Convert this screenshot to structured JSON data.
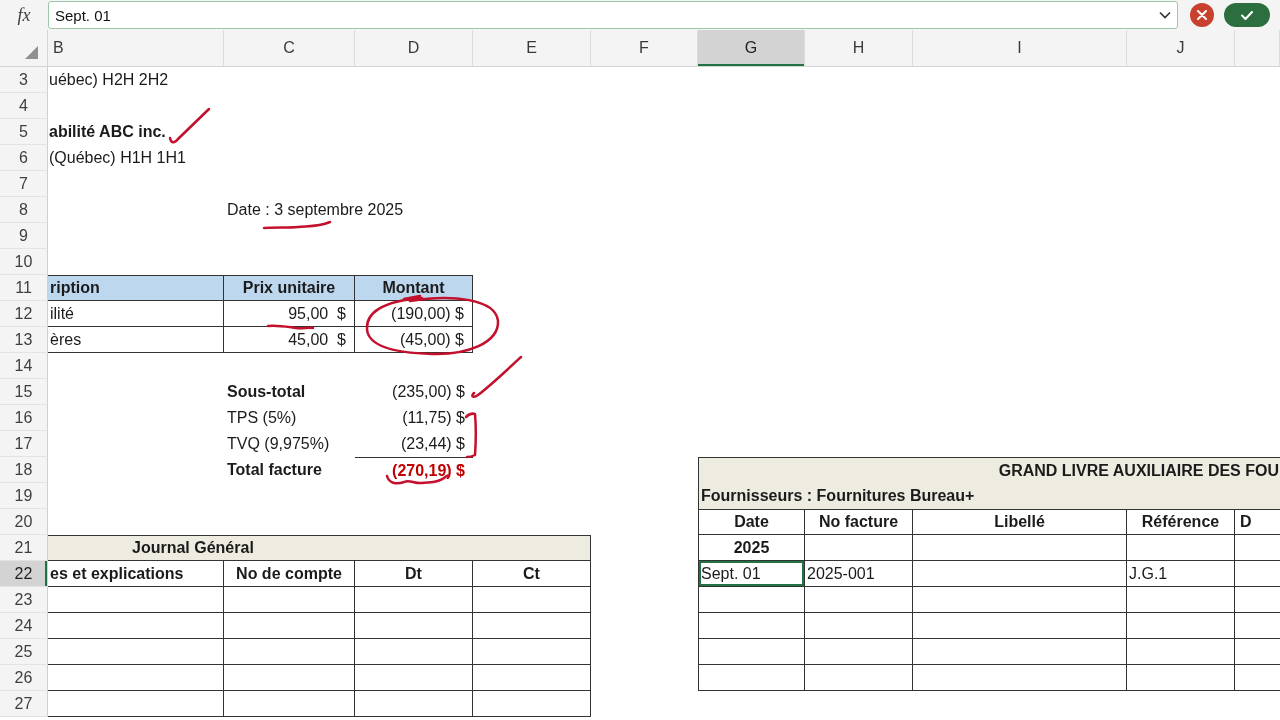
{
  "formula_bar": {
    "function_label": "fx",
    "value": "Sept. 01"
  },
  "columns": [
    {
      "label": "B",
      "selected": false
    },
    {
      "label": "C",
      "selected": false
    },
    {
      "label": "D",
      "selected": false
    },
    {
      "label": "E",
      "selected": false
    },
    {
      "label": "F",
      "selected": false
    },
    {
      "label": "G",
      "selected": true
    },
    {
      "label": "H",
      "selected": false
    },
    {
      "label": "I",
      "selected": false
    },
    {
      "label": "J",
      "selected": false
    }
  ],
  "rows": [
    {
      "label": "3",
      "selected": false
    },
    {
      "label": "4",
      "selected": false
    },
    {
      "label": "5",
      "selected": false
    },
    {
      "label": "6",
      "selected": false
    },
    {
      "label": "7",
      "selected": false
    },
    {
      "label": "8",
      "selected": false
    },
    {
      "label": "9",
      "selected": false
    },
    {
      "label": "10",
      "selected": false
    },
    {
      "label": "11",
      "selected": false
    },
    {
      "label": "12",
      "selected": false
    },
    {
      "label": "13",
      "selected": false
    },
    {
      "label": "14",
      "selected": false
    },
    {
      "label": "15",
      "selected": false
    },
    {
      "label": "16",
      "selected": false
    },
    {
      "label": "17",
      "selected": false
    },
    {
      "label": "18",
      "selected": false
    },
    {
      "label": "19",
      "selected": false
    },
    {
      "label": "20",
      "selected": false
    },
    {
      "label": "21",
      "selected": false
    },
    {
      "label": "22",
      "selected": true
    },
    {
      "label": "23",
      "selected": false
    },
    {
      "label": "24",
      "selected": false
    },
    {
      "label": "25",
      "selected": false
    },
    {
      "label": "26",
      "selected": false
    },
    {
      "label": "27",
      "selected": false
    }
  ],
  "company_block": [
    {
      "kind": "address",
      "text": "uébec) H2H 2H2"
    },
    {
      "kind": "name",
      "text": "abilité ABC inc."
    },
    {
      "kind": "address",
      "text": "(Québec) H1H 1H1"
    }
  ],
  "invoice_date": "Date : 3 septembre 2025",
  "invoice_table": {
    "columns": [
      "ription",
      "Prix unitaire",
      "Montant"
    ],
    "rows": [
      {
        "description": "ilité",
        "unit_price": "95,00  $",
        "amount": "(190,00) $"
      },
      {
        "description": "ères",
        "unit_price": "45,00  $",
        "amount": "(45,00) $"
      }
    ]
  },
  "totals": [
    {
      "kind": "subtotal",
      "label": "Sous-total",
      "amount": "(235,00) $"
    },
    {
      "kind": "tax",
      "label": "TPS (5%)",
      "amount": "(11,75) $"
    },
    {
      "kind": "tax",
      "label": "TVQ (9,975%)",
      "amount": "(23,44) $"
    },
    {
      "kind": "total",
      "label": "Total facture",
      "amount": "(270,19) $"
    }
  ],
  "journal": {
    "title": "Journal Général",
    "columns": [
      "es et explications",
      "No de compte",
      "Dt",
      "Ct"
    ]
  },
  "ledger": {
    "title": "GRAND LIVRE AUXILIAIRE DES FOU",
    "subtitle": "Fournisseurs : Fournitures Bureau+",
    "columns": [
      "Date",
      "No facture",
      "Libellé",
      "Référence",
      "D"
    ],
    "rows": [
      {
        "kind": "year",
        "date": "2025"
      },
      {
        "kind": "entry",
        "date": "Sept. 01",
        "invoice_no": "2025-001",
        "reference": "J.G.1"
      }
    ]
  }
}
